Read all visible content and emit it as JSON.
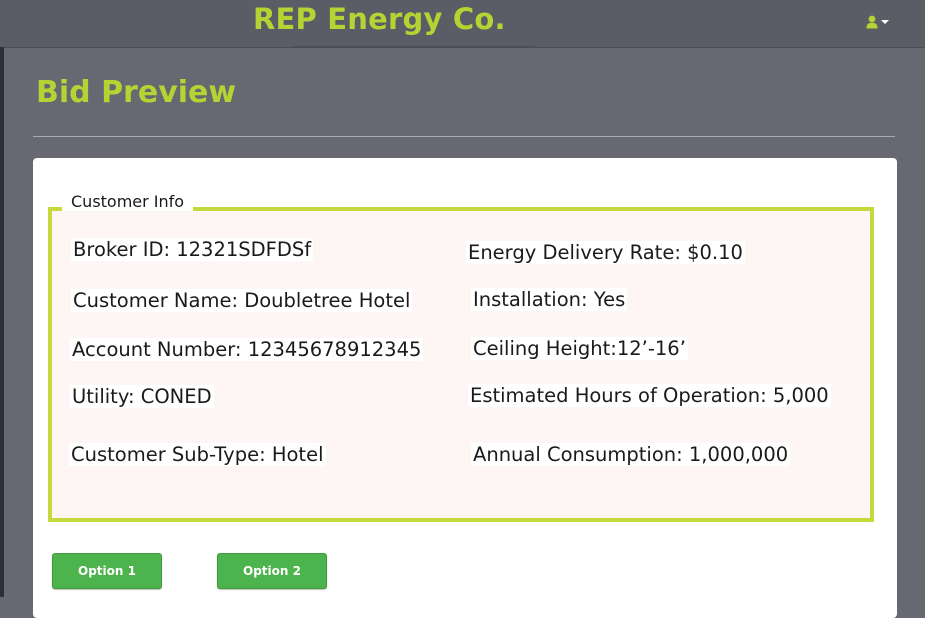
{
  "app": {
    "brand": "REP Energy Co."
  },
  "page": {
    "title": "Bid Preview"
  },
  "customer_info": {
    "legend": "Customer Info",
    "left_fields": [
      "Broker ID: 12321SDFDSf",
      "Customer Name: Doubletree Hotel",
      "Account Number: 12345678912345",
      "Utility: CONED",
      "Customer Sub-Type: Hotel"
    ],
    "right_fields": [
      "Energy Delivery Rate: $0.10",
      "Installation: Yes",
      "Ceiling Height:12’-16’",
      "Estimated Hours of Operation: 5,000",
      "Annual Consumption: 1,000,000"
    ]
  },
  "actions": {
    "option1_label": "Option 1",
    "option2_label": "Option 2"
  },
  "icons": {
    "user_menu": "user-icon",
    "user_menu_caret": "caret-down-icon"
  },
  "colors": {
    "accent_green": "#b6d334",
    "fieldset_border": "#c4d93b",
    "button_green": "#4db34c",
    "background": "#676872"
  }
}
